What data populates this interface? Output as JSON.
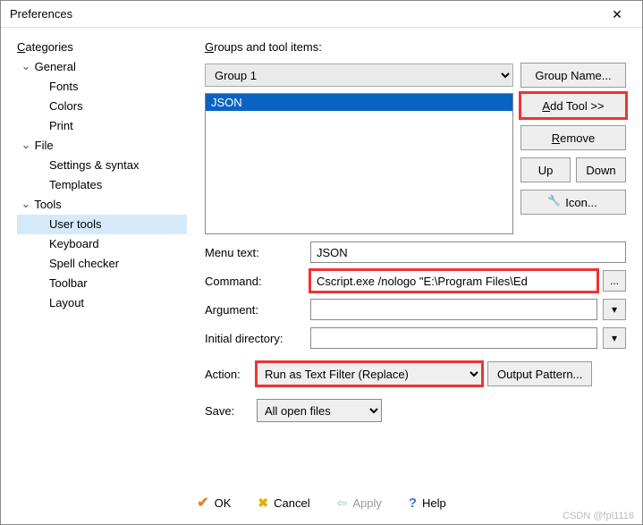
{
  "window": {
    "title": "Preferences"
  },
  "left_label": "Categories",
  "tree": {
    "general": {
      "label": "General",
      "fonts": "Fonts",
      "colors": "Colors",
      "print": "Print"
    },
    "file": {
      "label": "File",
      "settings": "Settings & syntax",
      "templates": "Templates"
    },
    "tools": {
      "label": "Tools",
      "usertools": "User tools",
      "keyboard": "Keyboard",
      "spell": "Spell checker",
      "toolbar": "Toolbar",
      "layout": "Layout"
    }
  },
  "right_label": "Groups and tool items:",
  "group_selected": "Group 1",
  "buttons": {
    "group_name": "Group Name...",
    "add_tool": "Add Tool >>",
    "remove": "Remove",
    "up": "Up",
    "down": "Down",
    "icon": "Icon...",
    "browse": "...",
    "dropdown": "▾",
    "output_pattern": "Output Pattern..."
  },
  "list": {
    "item0": "JSON"
  },
  "form": {
    "menu_text_label": "Menu text:",
    "menu_text_value": "JSON",
    "command_label": "Command:",
    "command_value": "Cscript.exe /nologo \"E:\\Program Files\\Ed",
    "argument_label": "Argument:",
    "argument_value": "",
    "initdir_label": "Initial directory:",
    "initdir_value": "",
    "action_label": "Action:",
    "action_value": "Run as Text Filter (Replace)",
    "save_label": "Save:",
    "save_value": "All open files"
  },
  "footer": {
    "ok": "OK",
    "cancel": "Cancel",
    "apply": "Apply",
    "help": "Help"
  },
  "watermark": "CSDN @fpl1116"
}
